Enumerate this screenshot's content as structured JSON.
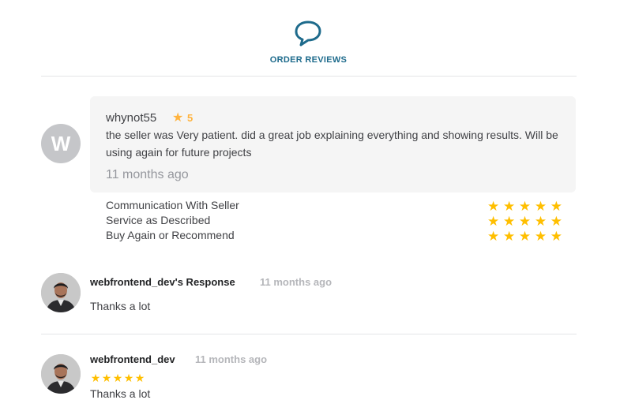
{
  "header": {
    "icon": "speech-bubble-icon",
    "title": "ORDER REVIEWS"
  },
  "review": {
    "avatar_letter": "W",
    "reviewer": "whynot55",
    "rating": "5",
    "text": "the seller was Very patient. did a great job explaining everything and showing results. Will be using again for future projects",
    "time": "11 months ago",
    "criteria": [
      {
        "label": "Communication With Seller",
        "stars": 5
      },
      {
        "label": "Service as Described",
        "stars": 5
      },
      {
        "label": "Buy Again or Recommend",
        "stars": 5
      }
    ]
  },
  "response": {
    "name": "webfrontend_dev's Response",
    "time": "11 months ago",
    "text": "Thanks a lot"
  },
  "seller_review": {
    "name": "webfrontend_dev",
    "time": "11 months ago",
    "stars": 5,
    "text": "Thanks a lot"
  },
  "colors": {
    "accent": "#1e6b8c",
    "star": "#ffbf00",
    "muted": "#95979d"
  }
}
